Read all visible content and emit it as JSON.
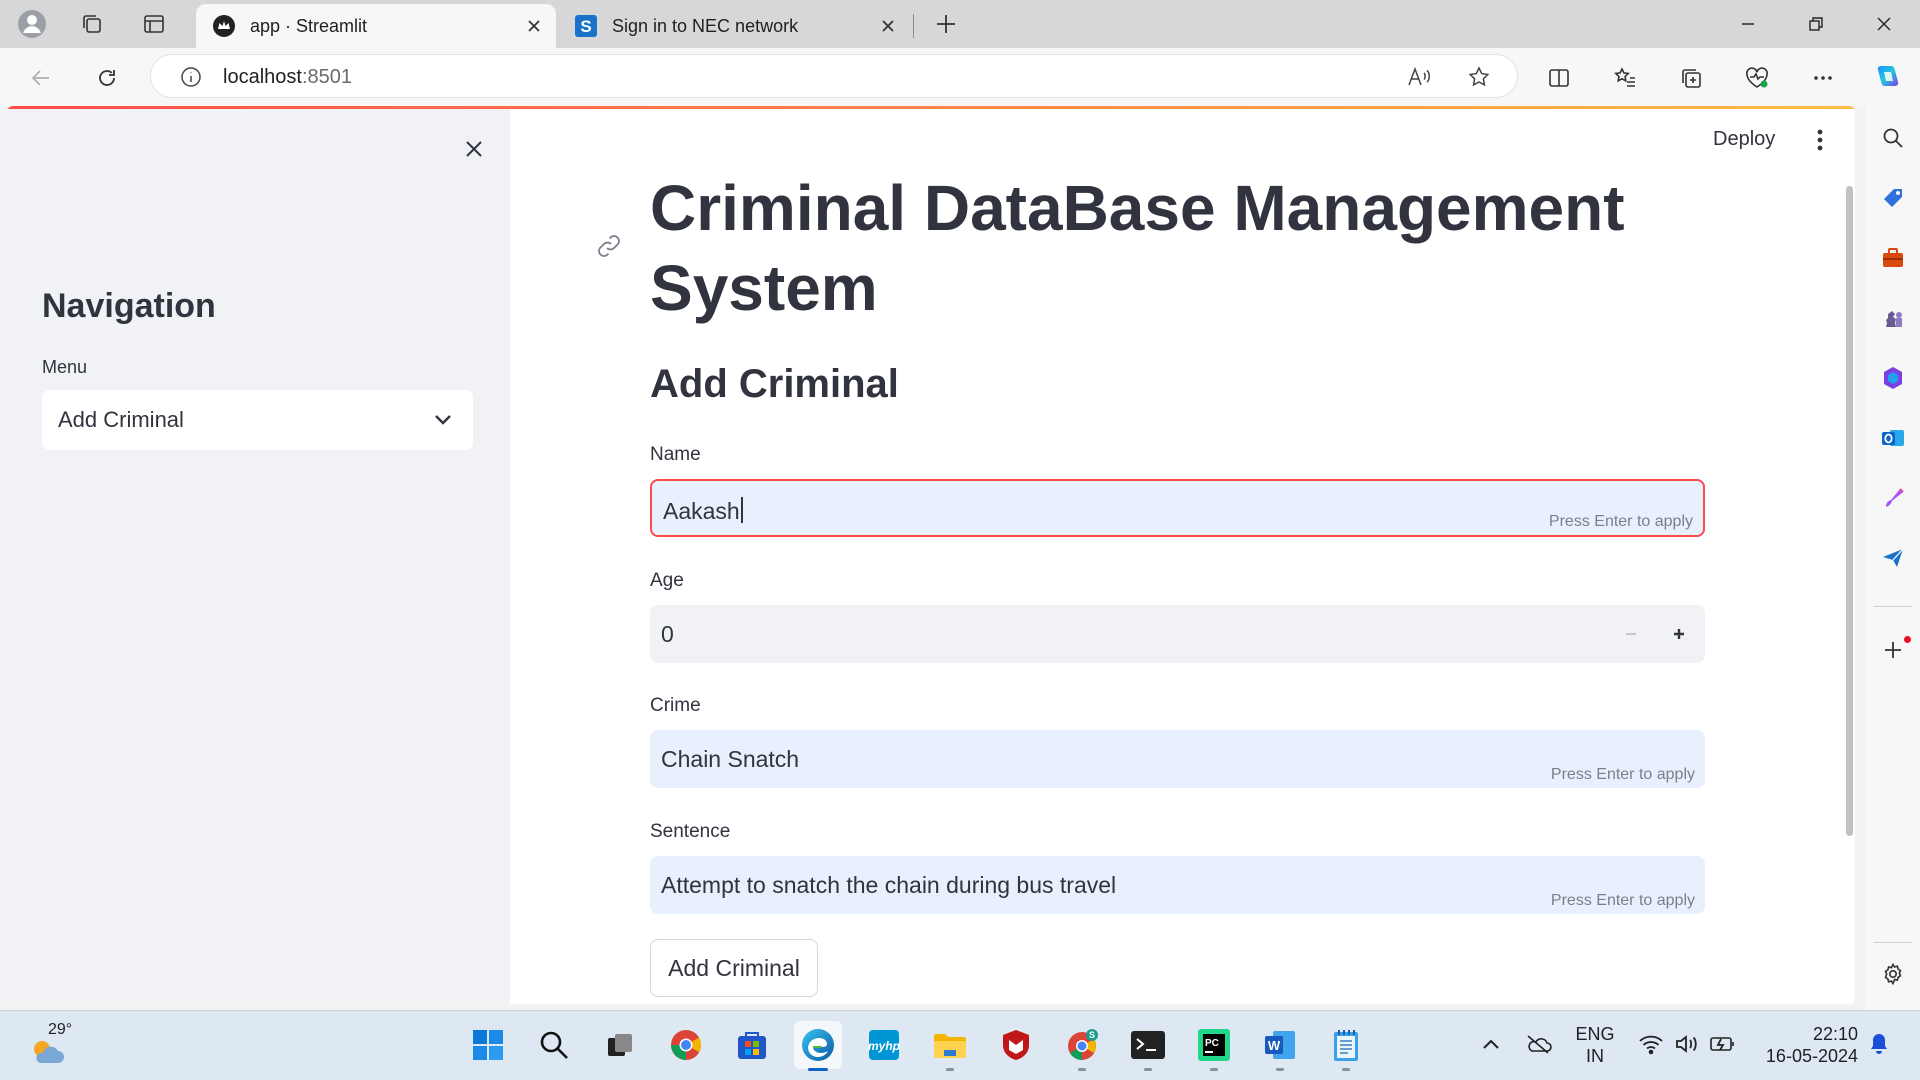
{
  "browser": {
    "tabs": [
      {
        "title": "app · Streamlit",
        "active": true
      },
      {
        "title": "Sign in to NEC network",
        "active": false
      }
    ],
    "url_host": "localhost",
    "url_port": ":8501"
  },
  "app": {
    "header": {
      "deploy_label": "Deploy"
    },
    "sidebar": {
      "title": "Navigation",
      "menu_label": "Menu",
      "menu_value": "Add Criminal"
    },
    "main": {
      "title": "Criminal DataBase Management System",
      "subtitle": "Add Criminal",
      "fields": {
        "name": {
          "label": "Name",
          "value": "Aakash",
          "hint": "Press Enter to apply"
        },
        "age": {
          "label": "Age",
          "value": "0"
        },
        "crime": {
          "label": "Crime",
          "value": "Chain Snatch",
          "hint": "Press Enter to apply"
        },
        "sentence": {
          "label": "Sentence",
          "value": "Attempt to snatch the chain during bus travel",
          "hint": "Press Enter to apply"
        }
      },
      "submit_label": "Add Criminal"
    }
  },
  "taskbar": {
    "weather_temp": "29°",
    "language": "ENG",
    "region": "IN",
    "time": "22:10",
    "date": "16-05-2024"
  },
  "colors": {
    "accent_red": "#ff4b4b",
    "input_bg": "#e8f0fe",
    "sidebar_bg": "#f0f2f6",
    "text": "#31333f"
  }
}
